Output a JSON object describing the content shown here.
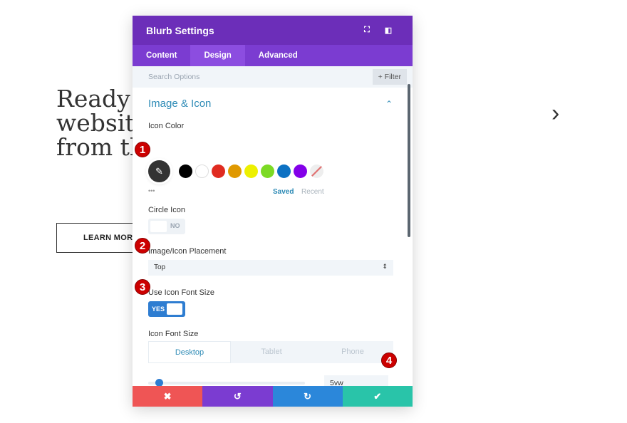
{
  "background": {
    "heading_lines": [
      "Ready t",
      "website",
      "from th"
    ],
    "learn_more": "LEARN MORE",
    "next_arrow": "›"
  },
  "modal": {
    "title": "Blurb Settings",
    "tabs": [
      "Content",
      "Design",
      "Advanced"
    ],
    "active_tab": "Design",
    "search_placeholder": "Search Options",
    "filter_label": "+ Filter",
    "section_title": "Image & Icon",
    "icon_color_label": "Icon Color",
    "swatches": [
      "#000000",
      "#ffffff",
      "#e02b20",
      "#e09900",
      "#edf000",
      "#7cda24",
      "#0c71c3",
      "#8300e9"
    ],
    "more_dots": "•••",
    "saved_label": "Saved",
    "recent_label": "Recent",
    "circle_icon_label": "Circle Icon",
    "circle_icon_value": "NO",
    "placement_label": "Image/Icon Placement",
    "placement_value": "Top",
    "use_font_size_label": "Use Icon Font Size",
    "use_font_size_value": "YES",
    "font_size_label": "Icon Font Size",
    "devices": [
      "Desktop",
      "Tablet",
      "Phone"
    ],
    "font_size_value": "5vw",
    "slider_fraction": 0.05,
    "footer_buttons": {
      "cancel": "✖",
      "undo": "↺",
      "redo": "↻",
      "save": "✔"
    }
  },
  "badges": [
    "1",
    "2",
    "3",
    "4"
  ]
}
